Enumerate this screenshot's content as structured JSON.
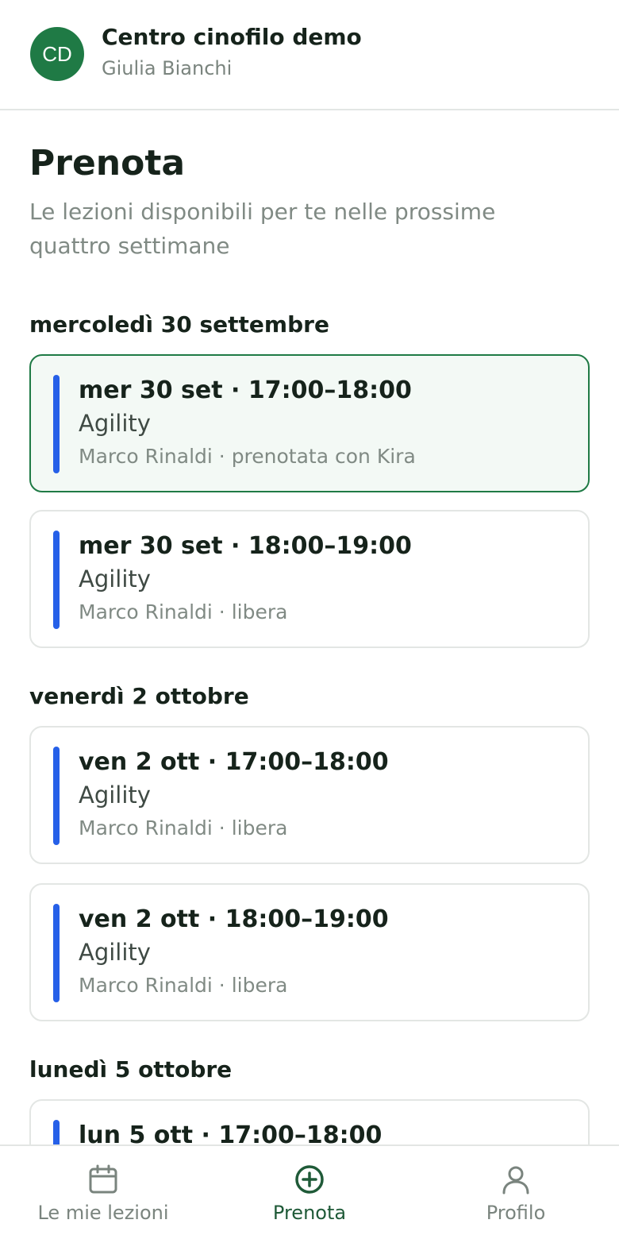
{
  "header": {
    "avatar_initials": "CD",
    "org_name": "Centro cinofilo demo",
    "user_name": "Giulia Bianchi"
  },
  "page": {
    "title": "Prenota",
    "subtitle": "Le lezioni disponibili per te nelle prossime quattro settimane"
  },
  "days": [
    {
      "heading": "mercoledì 30 settembre",
      "lessons": [
        {
          "time": "mer 30 set · 17:00–18:00",
          "type": "Agility",
          "meta": "Marco Rinaldi · prenotata con Kira",
          "booked": true
        },
        {
          "time": "mer 30 set · 18:00–19:00",
          "type": "Agility",
          "meta": "Marco Rinaldi · libera",
          "booked": false
        }
      ]
    },
    {
      "heading": "venerdì 2 ottobre",
      "lessons": [
        {
          "time": "ven 2 ott · 17:00–18:00",
          "type": "Agility",
          "meta": "Marco Rinaldi · libera",
          "booked": false
        },
        {
          "time": "ven 2 ott · 18:00–19:00",
          "type": "Agility",
          "meta": "Marco Rinaldi · libera",
          "booked": false
        }
      ]
    },
    {
      "heading": "lunedì 5 ottobre",
      "lessons": [
        {
          "time": "lun 5 ott · 17:00–18:00"
        }
      ]
    }
  ],
  "tabbar": {
    "tabs": [
      {
        "label": "Le mie lezioni",
        "icon": "calendar-icon",
        "active": false
      },
      {
        "label": "Prenota",
        "icon": "plus-circle-icon",
        "active": true
      },
      {
        "label": "Profilo",
        "icon": "user-icon",
        "active": false
      }
    ]
  },
  "colors": {
    "brand": "#1f7a45",
    "accent_bar": "#2660e8",
    "booked_background": "#f3f9f5"
  }
}
